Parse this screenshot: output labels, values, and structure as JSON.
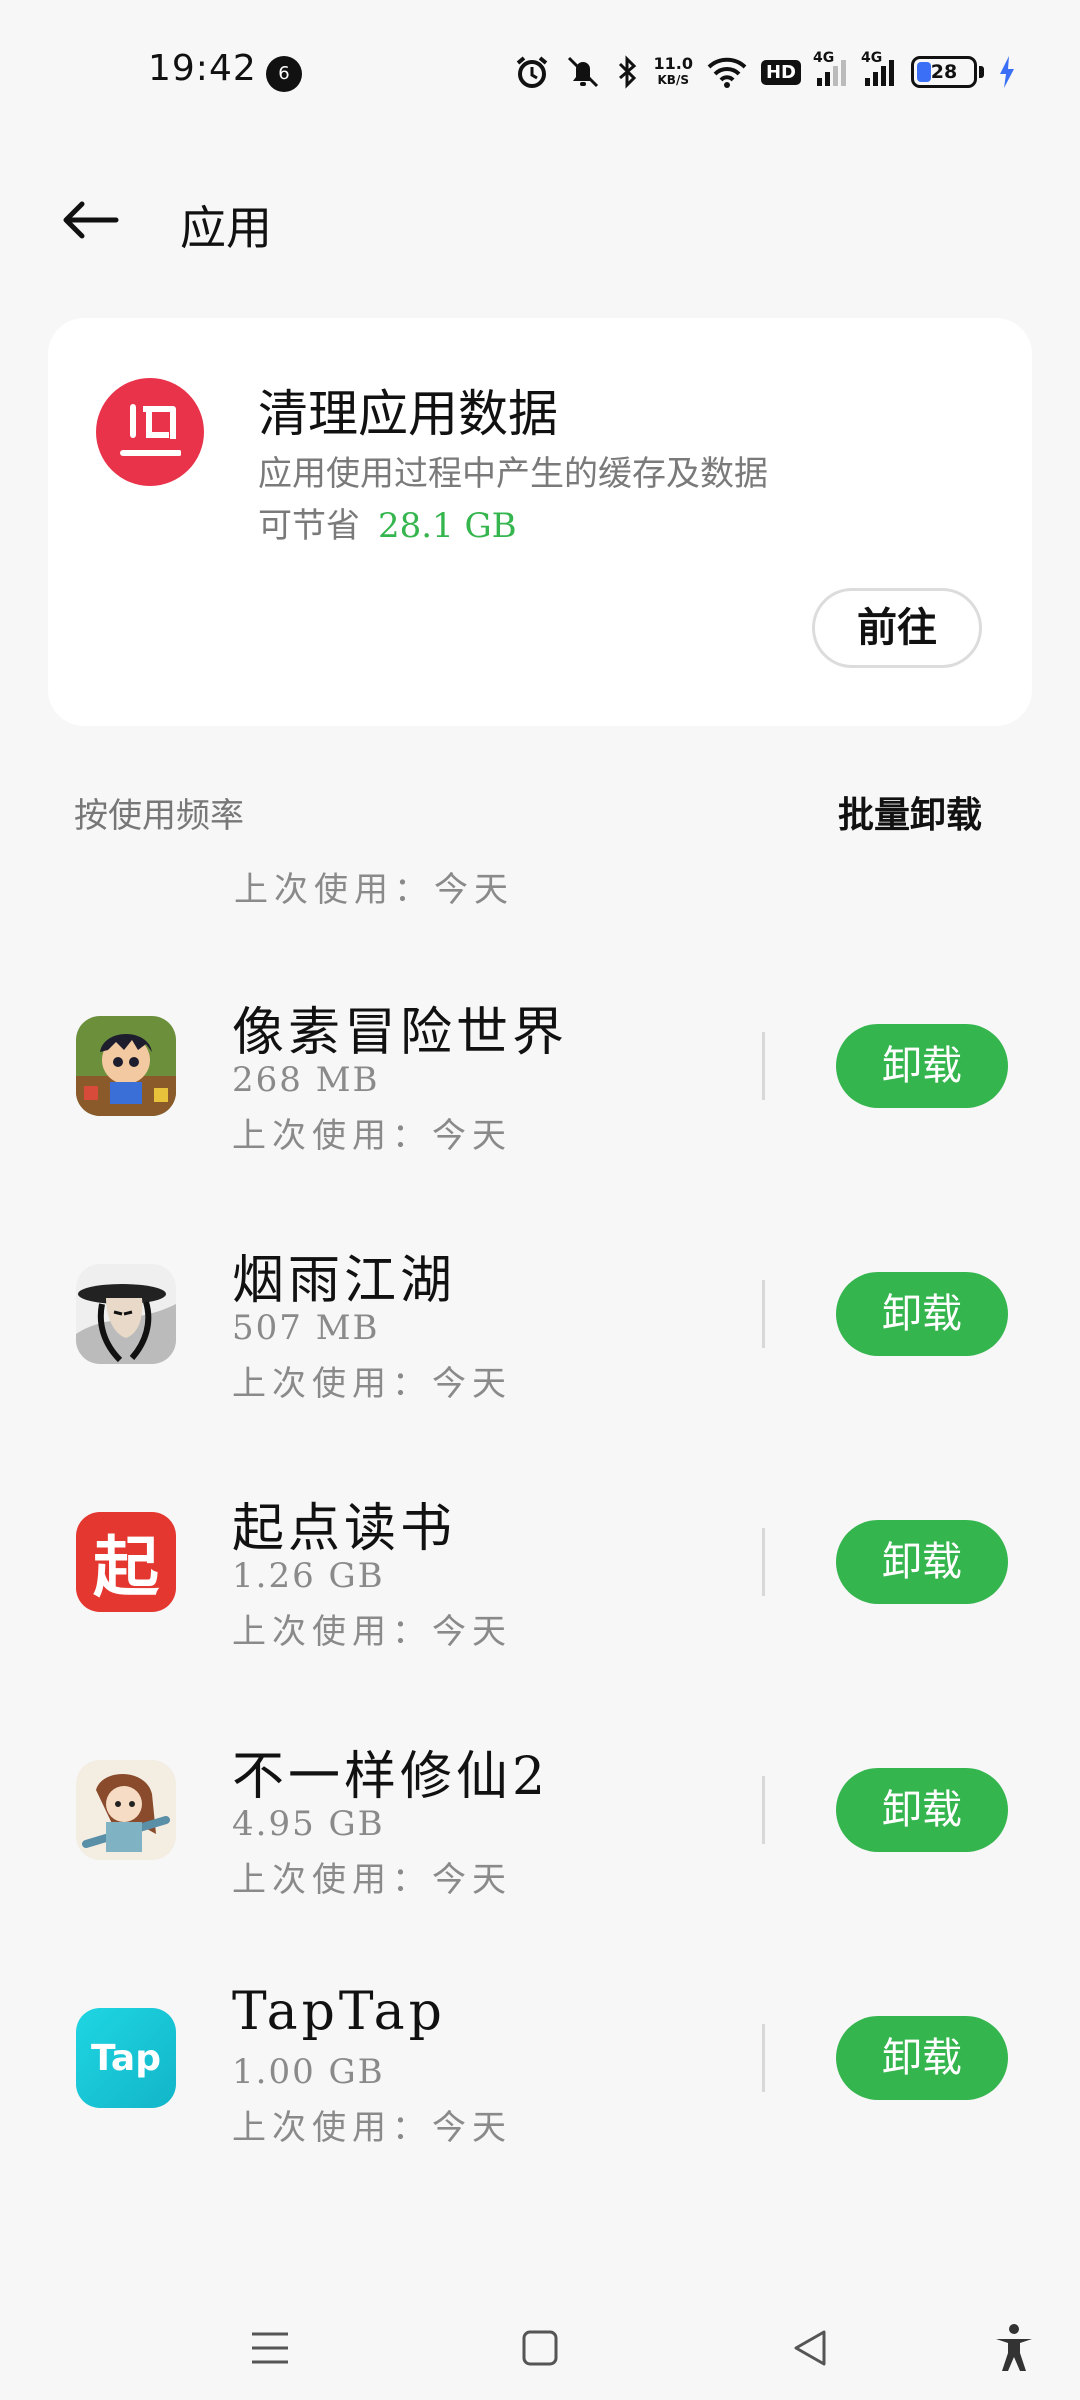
{
  "status_bar": {
    "time": "19:42",
    "notification_count": "6",
    "net_speed_value": "11.0",
    "net_speed_unit": "KB/S",
    "hd_label": "HD",
    "signal1_label": "4G",
    "signal2_label": "4G",
    "battery_level": "28",
    "battery_color": "#3b6ff5"
  },
  "header": {
    "title": "应用",
    "back_icon": "arrow-left-icon"
  },
  "clean_card": {
    "title": "清理应用数据",
    "description": "应用使用过程中产生的缓存及数据",
    "save_prefix": "可节省",
    "save_amount": "28.1 GB",
    "go_label": "前往",
    "icon_color": "#e8334a",
    "accent_color": "#35b54e"
  },
  "list_header": {
    "sort_label": "按使用频率",
    "batch_label": "批量卸载"
  },
  "partial_item": {
    "last_used": "上次使用：今天"
  },
  "apps": [
    {
      "name": "像素冒险世界",
      "size": "268 MB",
      "last_used": "上次使用：今天",
      "uninstall_label": "卸载",
      "icon": "pixel-adventure-icon"
    },
    {
      "name": "烟雨江湖",
      "size": "507 MB",
      "last_used": "上次使用：今天",
      "uninstall_label": "卸载",
      "icon": "yanyu-jianghu-icon"
    },
    {
      "name": "起点读书",
      "size": "1.26 GB",
      "last_used": "上次使用：今天",
      "uninstall_label": "卸载",
      "icon": "qidian-icon",
      "icon_text": "起"
    },
    {
      "name": "不一样修仙2",
      "size": "4.95 GB",
      "last_used": "上次使用：今天",
      "uninstall_label": "卸载",
      "icon": "xiuxian-icon"
    },
    {
      "name": "TapTap",
      "size": "1.00 GB",
      "last_used": "上次使用：今天",
      "uninstall_label": "卸载",
      "icon": "taptap-icon",
      "icon_text": "Tap"
    }
  ],
  "nav_bar": {
    "items": [
      "menu-icon",
      "home-icon",
      "back-icon",
      "accessibility-icon"
    ]
  }
}
